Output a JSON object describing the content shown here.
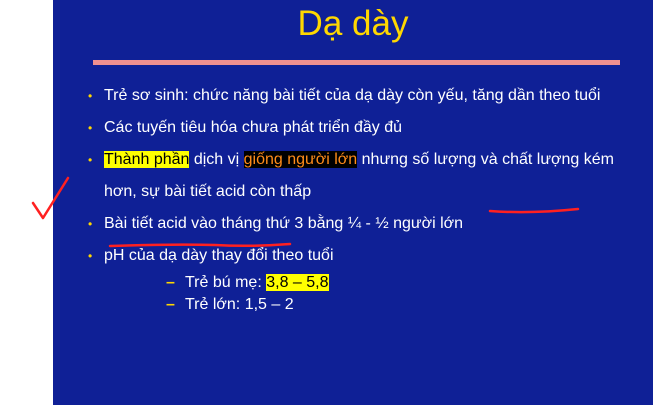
{
  "slide": {
    "title": "Dạ dày",
    "bullets": [
      {
        "parts": [
          {
            "text": "Trẻ sơ sinh: chức năng bài tiết của dạ dày còn yếu, tăng dần theo tuổi",
            "style": "plain"
          }
        ]
      },
      {
        "parts": [
          {
            "text": "Các tuyến tiêu hóa chưa phát triển đầy đủ",
            "style": "plain"
          }
        ]
      },
      {
        "parts": [
          {
            "text": "Thành phần",
            "style": "highlight-yellow"
          },
          {
            "text": " dịch vị ",
            "style": "plain"
          },
          {
            "text": "giống người lớn",
            "style": "highlight-black"
          },
          {
            "text": " nhưng số lượng và chất lượng kém hơn, sự bài tiết acid còn thấp",
            "style": "plain"
          }
        ]
      },
      {
        "parts": [
          {
            "text": "Bài tiết acid vào tháng thứ 3 bằng ¼ - ½ người lớn",
            "style": "plain"
          }
        ]
      },
      {
        "parts": [
          {
            "text": "pH của dạ dày thay đổi theo tuổi",
            "style": "plain"
          }
        ],
        "sub": [
          {
            "parts": [
              {
                "text": "Trẻ bú mẹ: ",
                "style": "plain"
              },
              {
                "text": "3,8 – 5,8",
                "style": "highlight-yellow"
              }
            ]
          },
          {
            "parts": [
              {
                "text": "Trẻ lớn: 1,5 – 2",
                "style": "plain"
              }
            ]
          }
        ]
      }
    ]
  },
  "colors": {
    "background": "#0f2096",
    "title": "#ffd700",
    "rule": "#ef9090",
    "bullet_marker": "#ffd700",
    "annotation": "#ff2020"
  }
}
